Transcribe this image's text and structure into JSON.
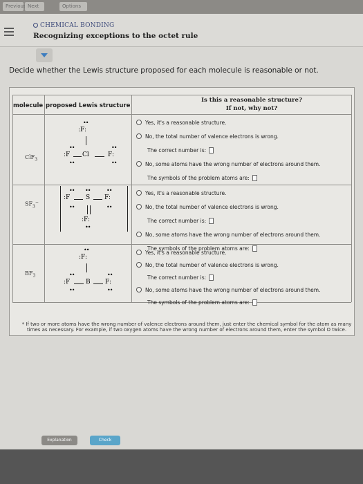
{
  "topbar": {
    "btn1": "Previous",
    "btn2": "Next",
    "btn3": "Options"
  },
  "header": {
    "topic": "CHEMICAL BONDING",
    "title": "Recognizing exceptions to the octet rule"
  },
  "instruction": "Decide whether the Lewis structure proposed for each molecule is reasonable or not.",
  "table": {
    "col_molecule": "molecule",
    "col_structure": "proposed Lewis structure",
    "col_question1": "Is this a reasonable structure?",
    "col_question2": "If not, why not?"
  },
  "rows": [
    {
      "molecule": "ClF",
      "molecule_sub": "3",
      "atoms": {
        "center": "Cl",
        "top": "F",
        "left": "F",
        "right": "F"
      },
      "opt_yes": "Yes, it's a reasonable structure.",
      "opt_valence": "No, the total number of valence electrons is wrong.",
      "correct_label": "The correct number is:",
      "opt_atoms": "No, some atoms have the wrong number of electrons around them.",
      "symbols_label": "The symbols of the problem atoms are:"
    },
    {
      "molecule": "SF",
      "molecule_sub": "3",
      "charge": "−",
      "atoms": {
        "center": "S",
        "bottom": "F",
        "left": "F",
        "right": "F"
      },
      "opt_yes": "Yes, it's a reasonable structure.",
      "opt_valence": "No, the total number of valence electrons is wrong.",
      "correct_label": "The correct number is:",
      "opt_atoms": "No, some atoms have the wrong number of electrons around them.",
      "symbols_label": "The symbols of the problem atoms are:"
    },
    {
      "molecule": "BF",
      "molecule_sub": "3",
      "atoms": {
        "center": "B",
        "top": "F",
        "left": "F",
        "right": "F"
      },
      "opt_yes": "Yes, it's a reasonable structure.",
      "opt_valence": "No, the total number of valence electrons is wrong.",
      "correct_label": "The correct number is:",
      "opt_atoms": "No, some atoms have the wrong number of electrons around them.",
      "symbols_label": "The symbols of the problem atoms are:"
    }
  ],
  "footnote": "* If two or more atoms have the wrong number of valence electrons around them, just enter the chemical symbol for the atom as many times as necessary. For example, if two oxygen atoms have the wrong number of electrons around them, enter the symbol O twice.",
  "buttons": {
    "explanation": "Explanation",
    "check": "Check"
  }
}
